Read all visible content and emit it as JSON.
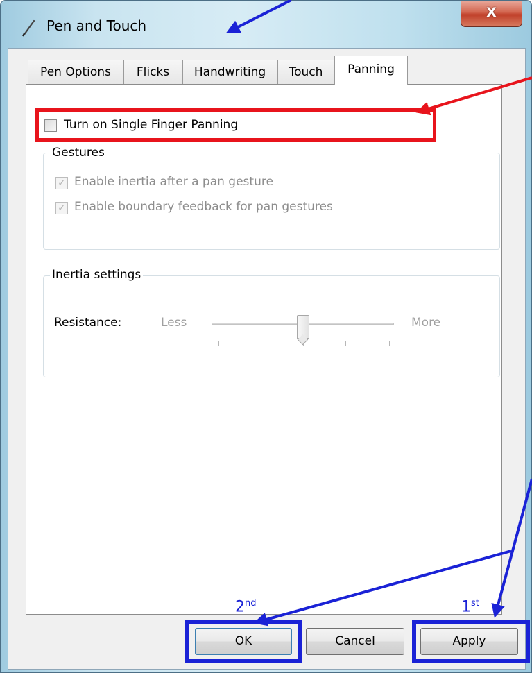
{
  "window": {
    "title": "Pen and Touch",
    "close_label": "X"
  },
  "tabs": [
    {
      "label": "Pen Options",
      "active": false
    },
    {
      "label": "Flicks",
      "active": false
    },
    {
      "label": "Handwriting",
      "active": false
    },
    {
      "label": "Touch",
      "active": false
    },
    {
      "label": "Panning",
      "active": true
    }
  ],
  "panning": {
    "single_finger_checkbox": {
      "label": "Turn on Single Finger Panning",
      "checked": false
    },
    "gestures": {
      "title": "Gestures",
      "options": [
        {
          "label": "Enable inertia after a pan gesture",
          "checked": true,
          "enabled": false
        },
        {
          "label": "Enable boundary feedback for pan gestures",
          "checked": true,
          "enabled": false
        }
      ]
    },
    "inertia": {
      "title": "Inertia settings",
      "resistance_label": "Resistance:",
      "min_label": "Less",
      "max_label": "More",
      "value_fraction": 0.5
    }
  },
  "buttons": {
    "ok": "OK",
    "cancel": "Cancel",
    "apply": "Apply"
  },
  "annotations": {
    "first": {
      "number": "1",
      "suffix": "st"
    },
    "second": {
      "number": "2",
      "suffix": "nd"
    },
    "colors": {
      "red": "#e8141c",
      "blue": "#1a22d6"
    }
  }
}
